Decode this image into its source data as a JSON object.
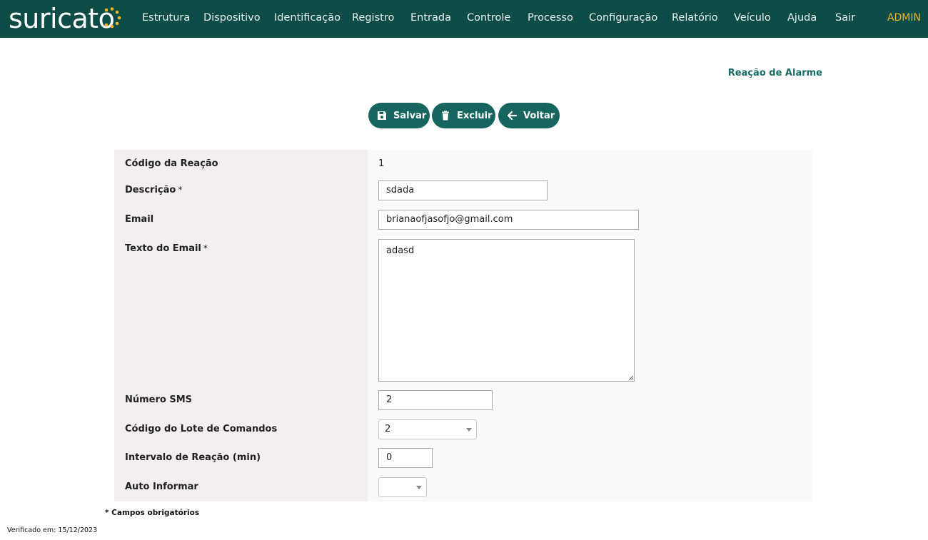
{
  "app": {
    "logo_text": "suricato",
    "colors": {
      "topbar": "#0e4d47",
      "accent": "#16665f",
      "admin": "#f0b323",
      "logo_dots": "#f0b323"
    }
  },
  "nav": {
    "items": [
      {
        "label": "Estrutura"
      },
      {
        "label": "Dispositivo"
      },
      {
        "label": "Identificação"
      },
      {
        "label": "Registro"
      },
      {
        "label": "Entrada"
      },
      {
        "label": "Controle"
      },
      {
        "label": "Processo"
      },
      {
        "label": "Configuração"
      },
      {
        "label": "Relatório"
      },
      {
        "label": "Veículo"
      },
      {
        "label": "Ajuda"
      },
      {
        "label": "Sair"
      }
    ],
    "user": "ADMIN"
  },
  "page": {
    "title": "Reação de Alarme"
  },
  "toolbar": {
    "save_label": "Salvar",
    "save_icon": "floppy-disk-icon",
    "delete_label": "Excluir",
    "delete_icon": "trash-icon",
    "back_label": "Voltar",
    "back_icon": "arrow-left-icon"
  },
  "form": {
    "codigo": {
      "label": "Código da Reação",
      "value": "1"
    },
    "descricao": {
      "label": "Descrição",
      "required": "*",
      "value": "sdada"
    },
    "email": {
      "label": "Email",
      "value": "brianaofjasofjo@gmail.com"
    },
    "texto_email": {
      "label": "Texto do Email",
      "required": "*",
      "value": "adasd"
    },
    "numero_sms": {
      "label": "Número SMS",
      "value": "2"
    },
    "lote_comandos": {
      "label": "Código do Lote de Comandos",
      "selected": "2"
    },
    "intervalo": {
      "label": "Intervalo de Reação (min)",
      "value": "0"
    },
    "auto_informar": {
      "label": "Auto Informar",
      "selected": ""
    }
  },
  "footer": {
    "required_note": "* Campos obrigatórios",
    "verified": "Verificado em: 15/12/2023"
  }
}
